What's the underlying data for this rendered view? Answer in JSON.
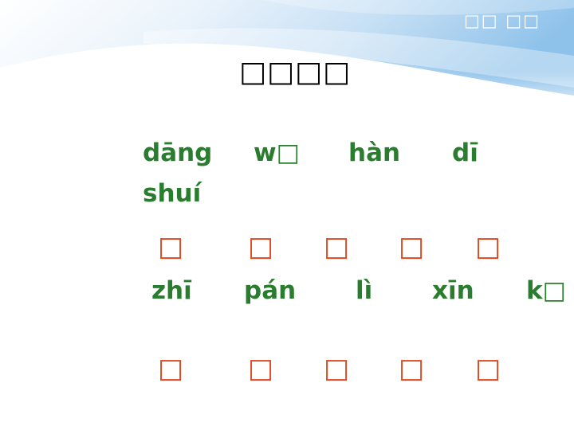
{
  "header": {
    "tag": "□□ □□"
  },
  "title": "□□□□",
  "row1": {
    "pinyin": [
      "dāng",
      "w□",
      "hàn",
      "dī",
      "shuí"
    ],
    "boxes": [
      "□",
      "□",
      "□",
      "□",
      "□"
    ]
  },
  "row2": {
    "pinyin": [
      "zhī",
      "pán",
      "lì",
      "xīn",
      "k□"
    ],
    "boxes": [
      "□",
      "□",
      "□",
      "□",
      "□"
    ]
  },
  "colors": {
    "pinyin": "#2a7d2e",
    "box": "#e2481e",
    "sky_top": "#bcd9f2"
  }
}
